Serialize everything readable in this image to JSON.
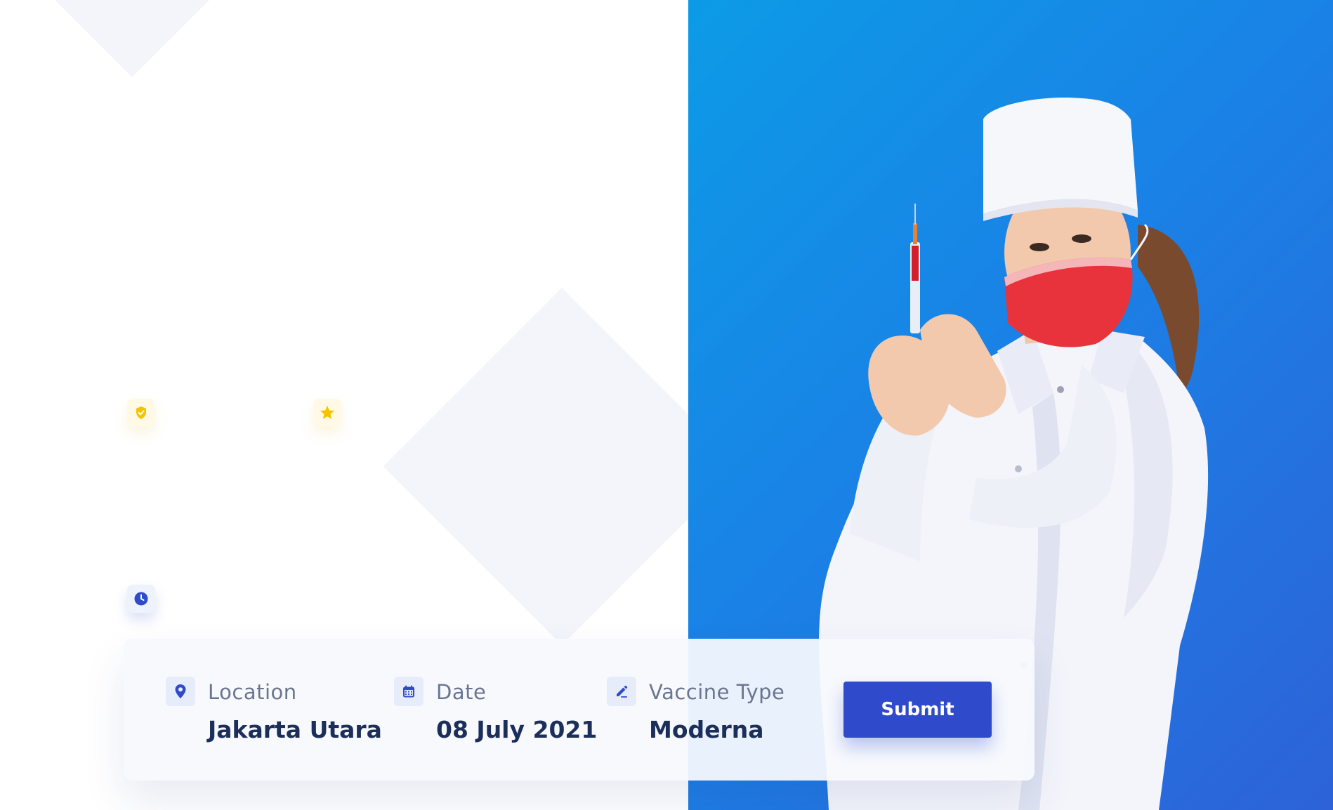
{
  "search": {
    "location": {
      "label": "Location",
      "value": "Jakarta Utara",
      "icon": "map-pin-icon"
    },
    "date": {
      "label": "Date",
      "value": "08 July 2021",
      "icon": "calendar-icon"
    },
    "vaccine": {
      "label": "Vaccine Type",
      "value": "Moderna",
      "icon": "pen-icon"
    },
    "submit_label": "Submit"
  },
  "badges": [
    {
      "icon": "shield-check-icon",
      "color": "#f5c400"
    },
    {
      "icon": "star-icon",
      "color": "#f5c400"
    },
    {
      "icon": "clock-icon",
      "color": "#2f4bcb"
    }
  ],
  "colors": {
    "accent": "#2f4bcb",
    "hero_from": "#0c9be6",
    "hero_to": "#2d62d8",
    "heading": "#1c2f5b",
    "muted": "#6b7591"
  }
}
